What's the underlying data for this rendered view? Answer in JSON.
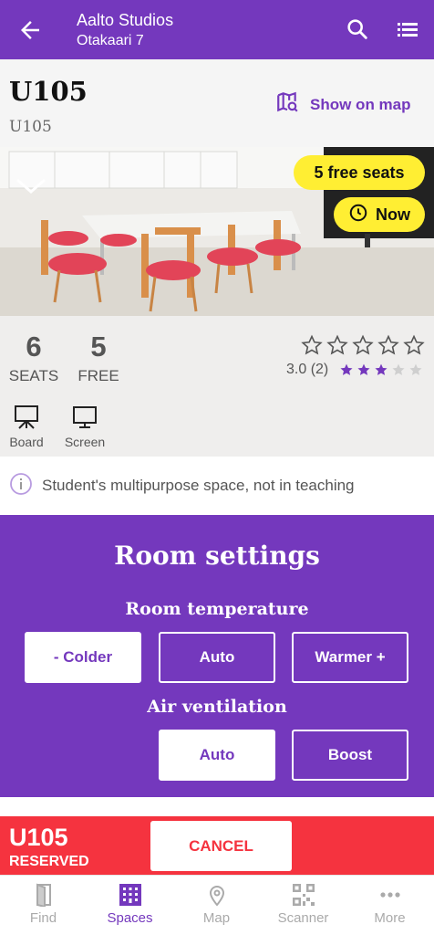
{
  "header": {
    "building": "Aalto Studios",
    "address": "Otakaari 7",
    "back_icon": "arrow-left-icon",
    "search_icon": "search-icon",
    "list_icon": "list-icon"
  },
  "room": {
    "name": "U105",
    "subtitle": "U105",
    "show_on_map": "Show on map"
  },
  "photo": {
    "free_seats_badge": "5 free seats",
    "time_badge": "Now"
  },
  "stats": {
    "seats_value": "6",
    "seats_label": "SEATS",
    "free_value": "5",
    "free_label": "FREE"
  },
  "rating": {
    "text": "3.0 (2)",
    "value": 3,
    "max": 5
  },
  "equipment": [
    {
      "label": "Board",
      "icon": "board-icon"
    },
    {
      "label": "Screen",
      "icon": "screen-icon"
    }
  ],
  "note": "Student's multipurpose space, not in teaching",
  "settings": {
    "title": "Room settings",
    "temperature_title": "Room temperature",
    "temperature_options": [
      "- Colder",
      "Auto",
      "Warmer +"
    ],
    "temperature_selected": "- Colder",
    "ventilation_title": "Air ventilation",
    "ventilation_options": [
      "Auto",
      "Boost"
    ],
    "ventilation_selected": "Auto"
  },
  "reservation": {
    "room": "U105",
    "status": "RESERVED",
    "cancel_label": "CANCEL"
  },
  "bottom_nav": [
    {
      "label": "Find",
      "icon": "door-icon"
    },
    {
      "label": "Spaces",
      "icon": "building-icon",
      "active": true
    },
    {
      "label": "Map",
      "icon": "map-pin-icon"
    },
    {
      "label": "Scanner",
      "icon": "qr-code-icon"
    },
    {
      "label": "More",
      "icon": "more-dots-icon"
    }
  ],
  "colors": {
    "primary": "#7438bd",
    "accent_yellow": "#ffee33",
    "reserved_red": "#f5333f"
  }
}
